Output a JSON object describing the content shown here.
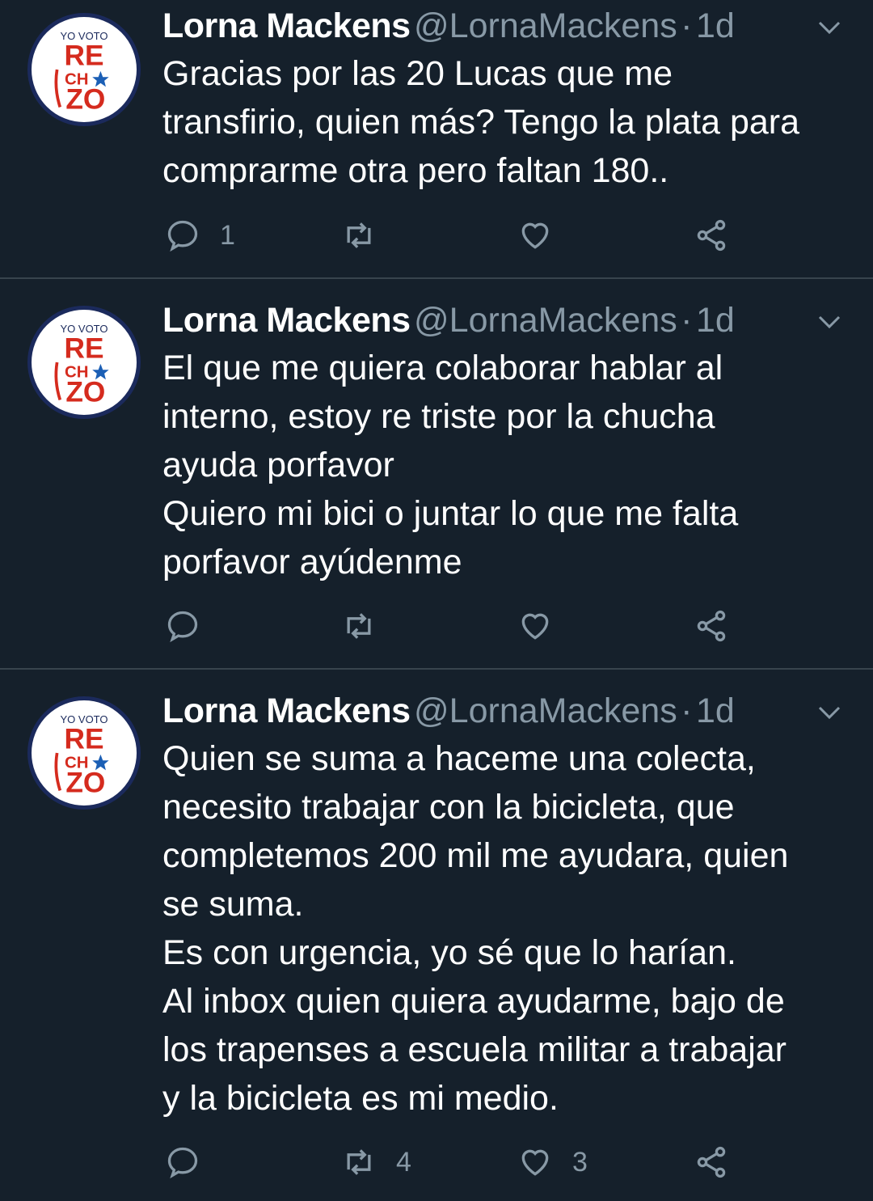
{
  "theme": {
    "background": "#15202b",
    "text": "#ffffff",
    "secondary": "#8899a6",
    "divider": "#38444d"
  },
  "avatar": {
    "line1": "YO VOTO",
    "line2": "RE",
    "line3": "CH",
    "line4": "ZO",
    "icon": "rechazo-badge-avatar"
  },
  "tweets": [
    {
      "name": "Lorna Mackens",
      "handle": "@LornaMackens",
      "separator": "·",
      "time": "1d",
      "text": "Gracias por las 20 Lucas que me\ntransfirio, quien más? Tengo la plata para\ncomprarme otra pero faltan 180..",
      "replies": "1",
      "retweets": "",
      "likes": ""
    },
    {
      "name": "Lorna Mackens",
      "handle": "@LornaMackens",
      "separator": "·",
      "time": "1d",
      "text": "El que me quiera colaborar hablar al\ninterno, estoy re triste por la chucha\nayuda porfavor\nQuiero mi bici o juntar lo que me falta\nporfavor ayúdenme",
      "replies": "",
      "retweets": "",
      "likes": ""
    },
    {
      "name": "Lorna Mackens",
      "handle": "@LornaMackens",
      "separator": "·",
      "time": "1d",
      "text": "Quien se suma a haceme una colecta,\nnecesito trabajar con la bicicleta, que\ncompletemos 200 mil me ayudara, quien\nse suma.\nEs con urgencia, yo sé que lo harían.\nAl inbox quien quiera ayudarme, bajo de\nlos trapenses a escuela militar a trabajar\ny la bicicleta es mi medio.",
      "replies": "",
      "retweets": "4",
      "likes": "3"
    }
  ],
  "icons": {
    "reply": "reply-icon",
    "retweet": "retweet-icon",
    "like": "like-icon",
    "share": "share-icon",
    "more": "chevron-down-icon"
  }
}
